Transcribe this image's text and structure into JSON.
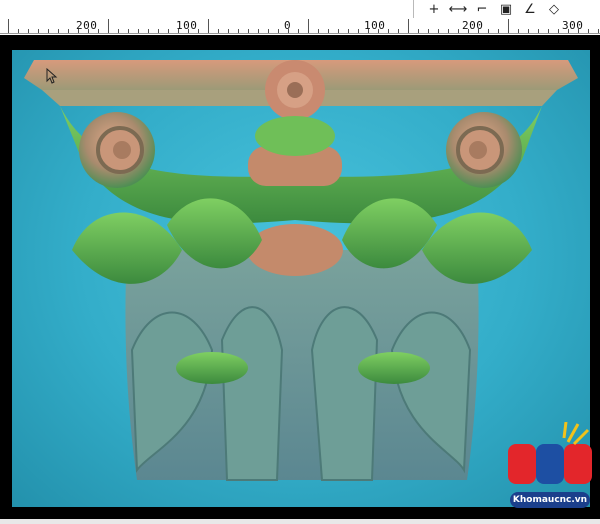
{
  "toolbar": {
    "tools": [
      {
        "name": "plus-tool-icon",
        "glyph": "+"
      },
      {
        "name": "dimension-tool-icon",
        "glyph": "⟷"
      },
      {
        "name": "step-tool-icon",
        "glyph": "⌐"
      },
      {
        "name": "box-tool-icon",
        "glyph": "▣"
      },
      {
        "name": "angle-tool-icon",
        "glyph": "∠"
      },
      {
        "name": "shape-tool-icon",
        "glyph": "◇"
      }
    ]
  },
  "ruler": {
    "labels": [
      "200",
      "100",
      "0",
      "100",
      "200",
      "300"
    ]
  },
  "watermark": {
    "brand": "CNC",
    "caption": "Khomaucnc.vn",
    "colors": {
      "c": "#e3262b",
      "n": "#1d4fa3",
      "accent": "#f2c21b"
    }
  },
  "colors": {
    "background": "#000000",
    "canvas": "#38b3cf",
    "relief_top": "#c98f6f",
    "relief_green": "#52a64a",
    "relief_body": "#6f9ca0"
  }
}
